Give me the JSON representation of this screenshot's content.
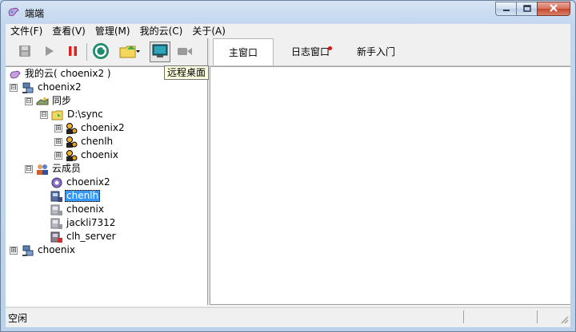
{
  "window": {
    "title": "端端",
    "app_icon": "app-logo-icon",
    "controls": {
      "minimize": "minimize-icon",
      "maximize": "maximize-icon",
      "close": "close-icon"
    }
  },
  "menu": {
    "items": [
      {
        "label": "文件(F)"
      },
      {
        "label": "查看(V)"
      },
      {
        "label": "管理(M)"
      },
      {
        "label": "我的云(C)"
      },
      {
        "label": "关于(A)"
      }
    ]
  },
  "toolbar": {
    "buttons": [
      "save-icon",
      "play-icon",
      "pause-icon",
      "refresh-icon",
      "upload-folder-icon",
      "remote-desktop-icon",
      "video-camera-icon"
    ],
    "tooltip": "远程桌面"
  },
  "tabs": [
    {
      "label": "主窗口",
      "active": true
    },
    {
      "label": "日志窗口",
      "active": false,
      "notification": true
    },
    {
      "label": "新手入门",
      "active": false
    }
  ],
  "tree": {
    "root_label": "我的云( choenix2 )",
    "nodes": {
      "choenix2": "choenix2",
      "sync": "同步",
      "dsync": "D:\\sync",
      "sync_choenix2": "choenix2",
      "sync_chenlh": "chenlh",
      "sync_choenix": "choenix",
      "members": "云成员",
      "m_choenix2": "choenix2",
      "m_chenlh": "chenlh",
      "m_choenix": "choenix",
      "m_jackli7312": "jackli7312",
      "m_clh_server": "clh_server",
      "choenix": "choenix"
    },
    "selected": "chenlh",
    "expand_open": "⊟",
    "expand_closed": "⊞"
  },
  "status": {
    "text": "空闲"
  },
  "colors": {
    "selection": "#3399ff",
    "notification_dot": "#e01010",
    "pause": "#d9231c",
    "refresh": "#1e8a6e"
  }
}
